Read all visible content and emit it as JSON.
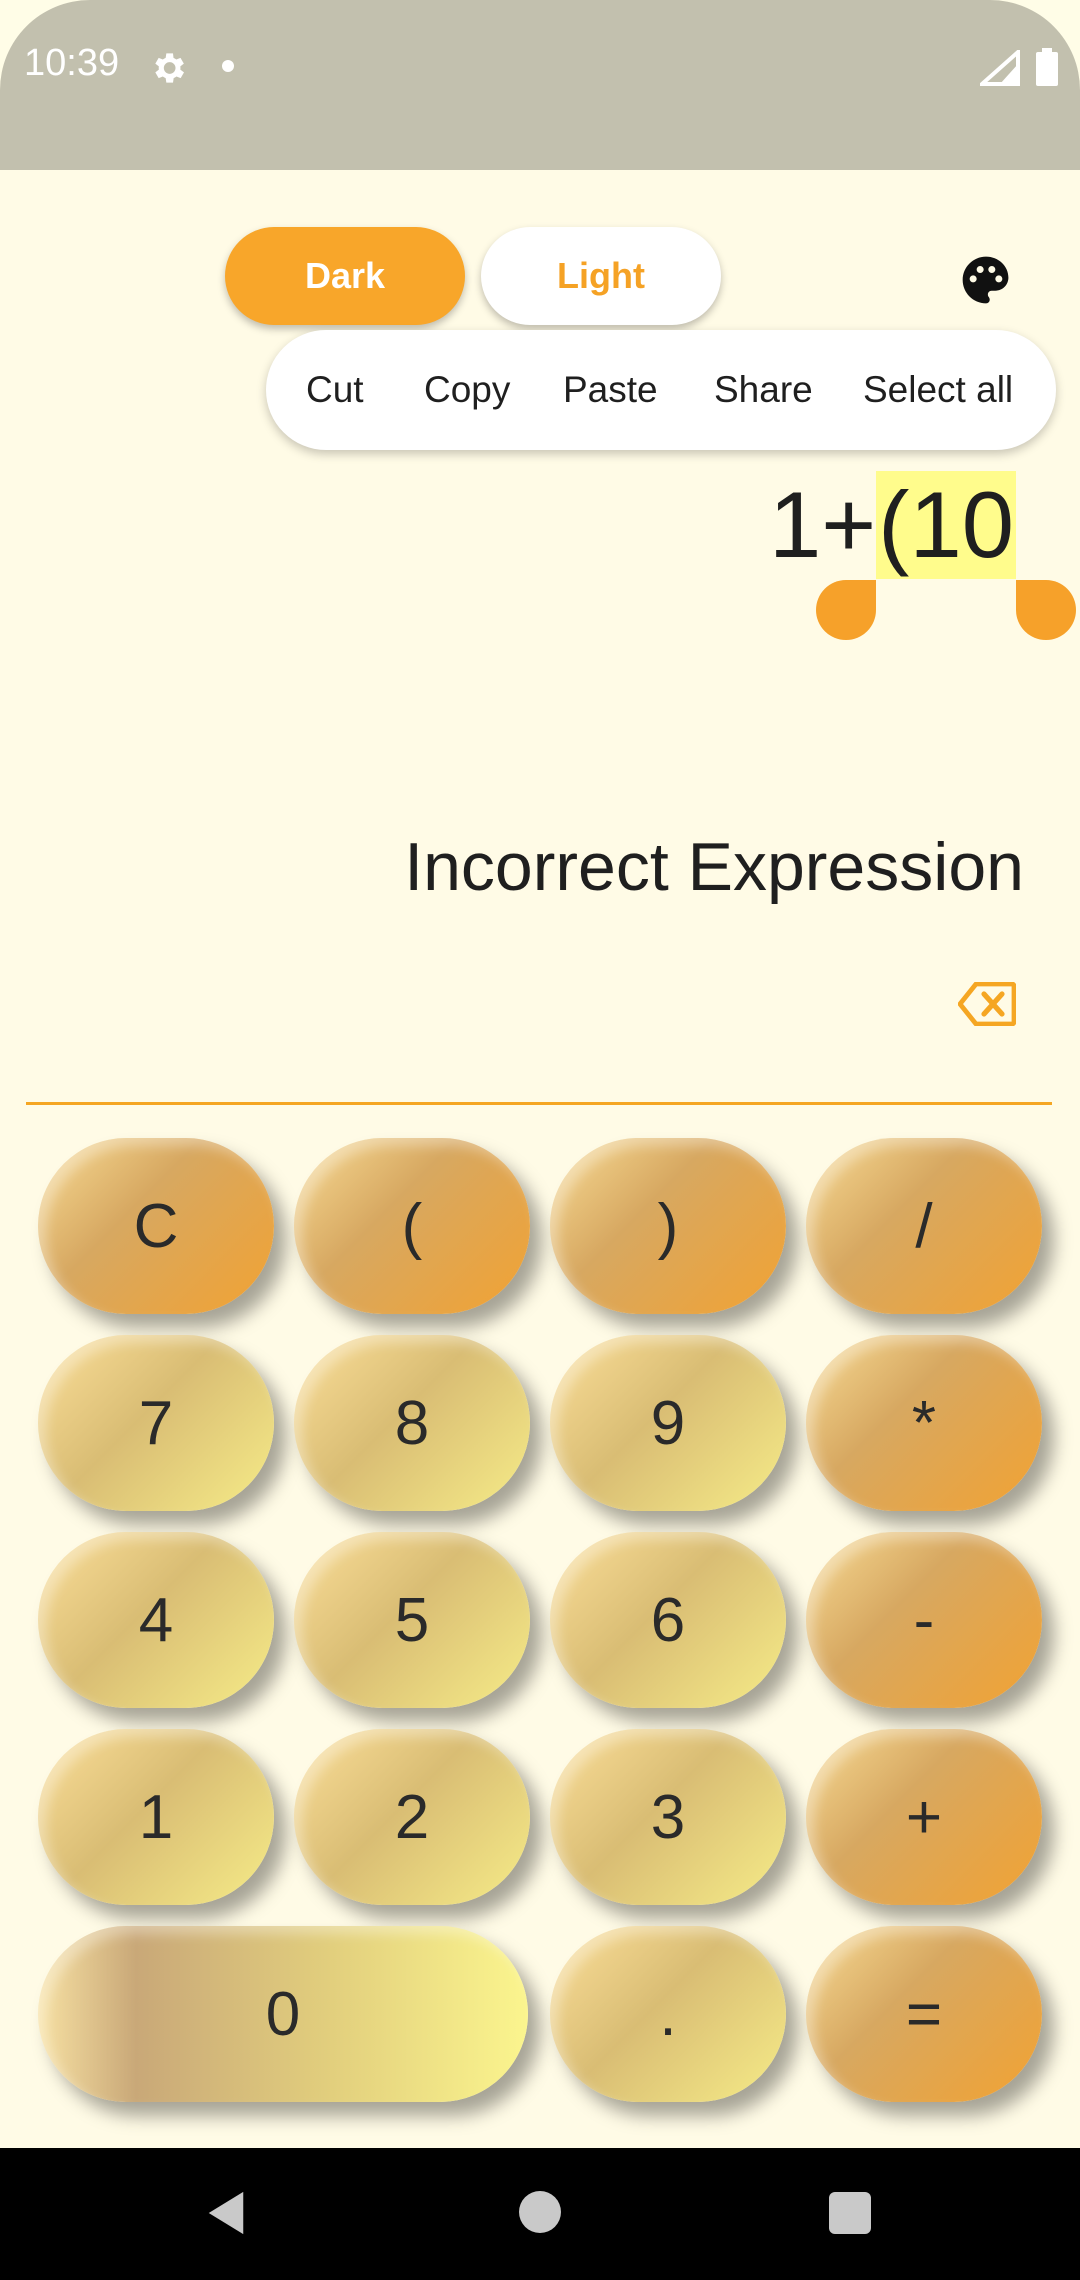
{
  "status_bar": {
    "time": "10:39"
  },
  "theme_toggle": {
    "dark_label": "Dark",
    "light_label": "Light",
    "selected": "Dark"
  },
  "context_menu": {
    "items": [
      "Cut",
      "Copy",
      "Paste",
      "Share",
      "Select all"
    ]
  },
  "expression": {
    "prefix": "1+",
    "selected": "(10"
  },
  "result": {
    "text": "Incorrect Expression"
  },
  "keypad": {
    "rows": [
      [
        "C",
        "(",
        ")",
        "/"
      ],
      [
        "7",
        "8",
        "9",
        "*"
      ],
      [
        "4",
        "5",
        "6",
        "-"
      ],
      [
        "1",
        "2",
        "3",
        "+"
      ],
      [
        "0",
        ".",
        "="
      ]
    ]
  },
  "colors": {
    "accent": "#f8a62a",
    "background": "#fffbe6",
    "selection": "#fffc8c"
  },
  "icons": [
    "gear-icon",
    "signal-icon",
    "battery-icon",
    "palette-icon",
    "backspace-icon",
    "back-icon",
    "home-icon",
    "recent-apps-icon"
  ]
}
